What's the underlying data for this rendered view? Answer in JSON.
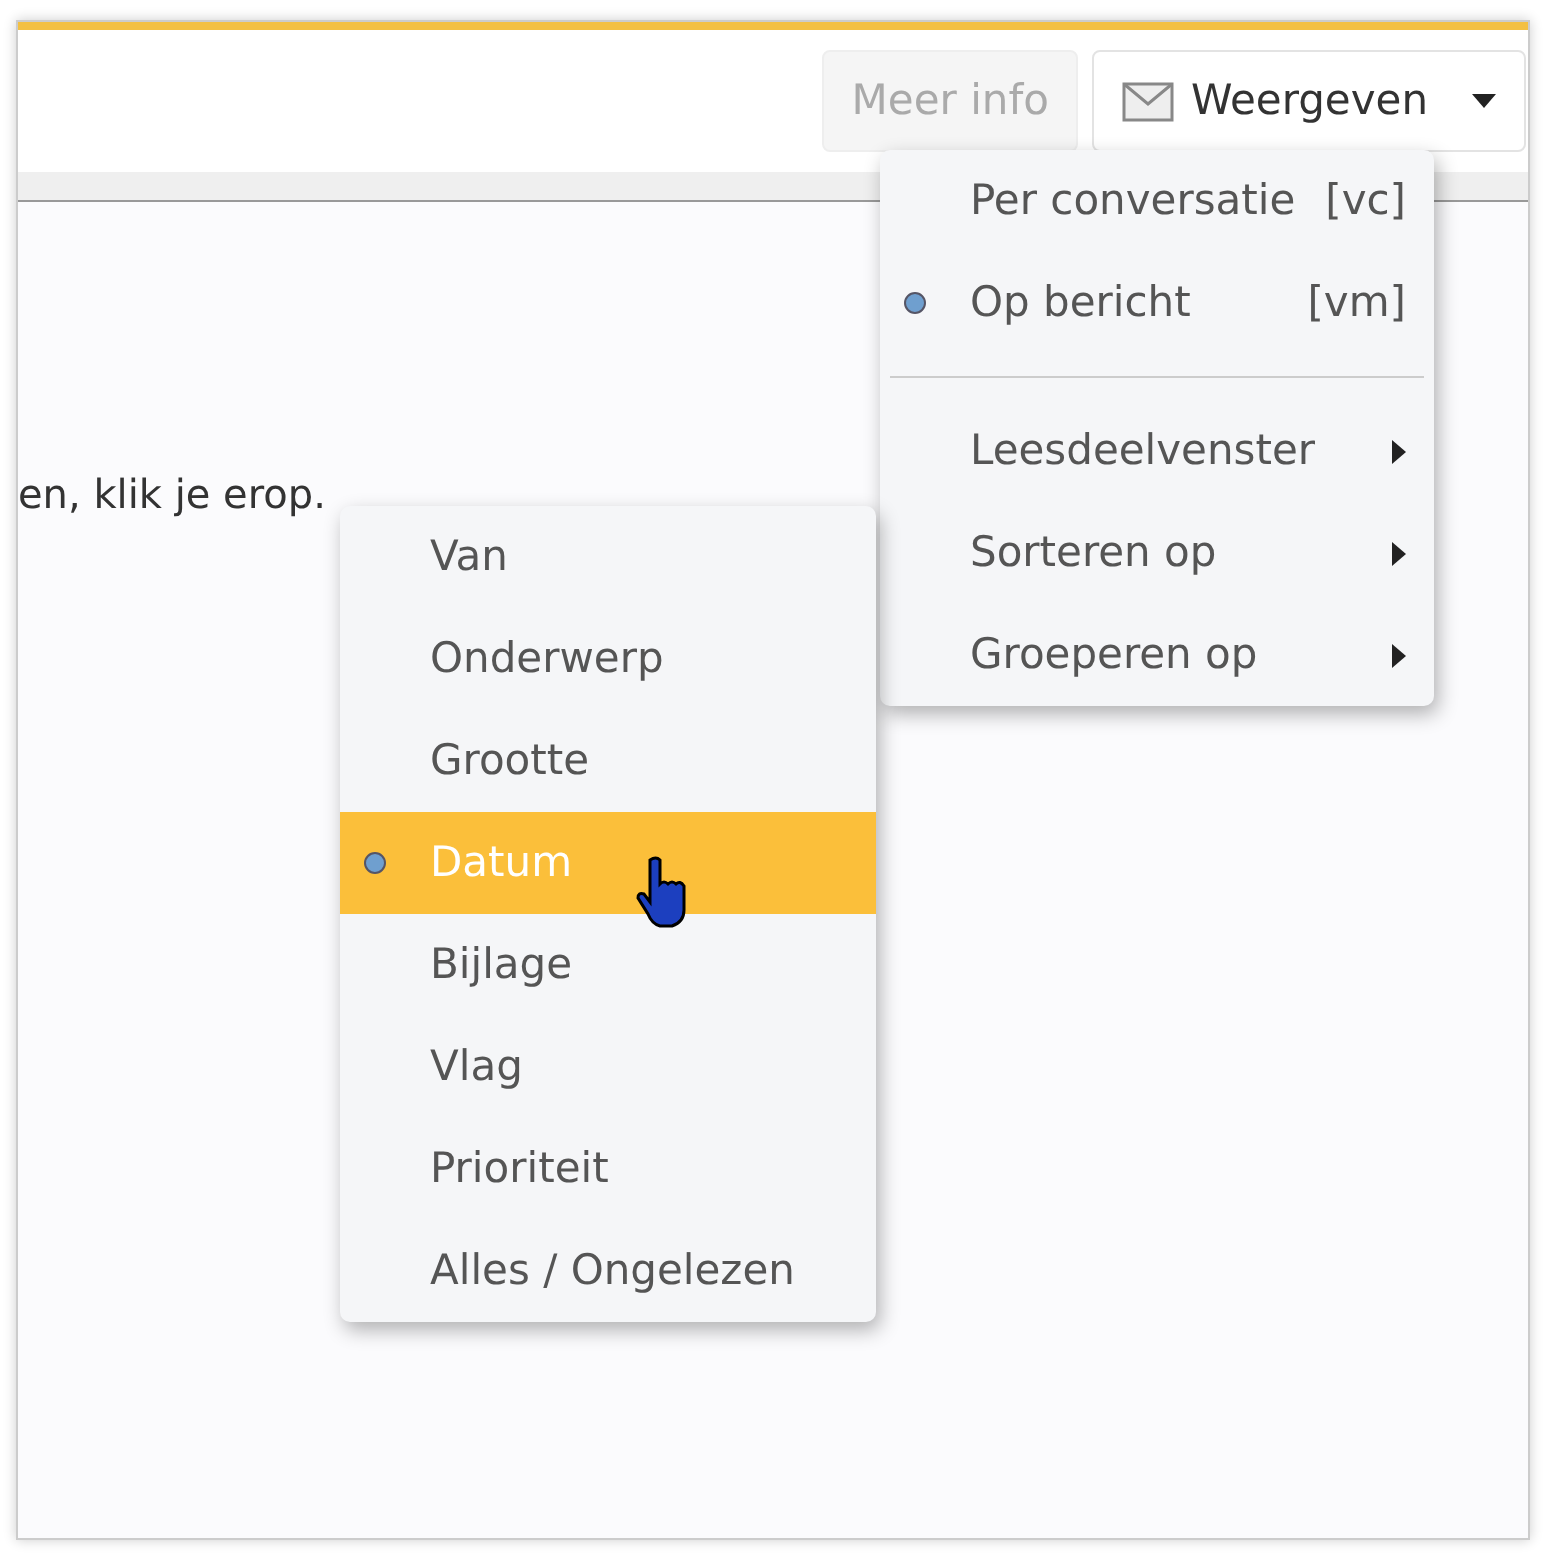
{
  "toolbar": {
    "buttons": [
      {
        "kind": "plain",
        "label": "Meer info",
        "disabled": true
      },
      {
        "kind": "dropdown",
        "label": "Weergeven",
        "disabled": false
      }
    ]
  },
  "content": {
    "text": "en, klik je erop."
  },
  "view_menu": {
    "items": [
      {
        "kind": "radio",
        "label": "Per conversatie",
        "shortcut": "[vc]",
        "selected": false
      },
      {
        "kind": "radio",
        "label": "Op bericht",
        "shortcut": "[vm]",
        "selected": true
      },
      {
        "kind": "separator"
      },
      {
        "kind": "submenu",
        "label": "Leesdeelvenster"
      },
      {
        "kind": "submenu",
        "label": "Sorteren op"
      },
      {
        "kind": "submenu",
        "label": "Groeperen op"
      }
    ]
  },
  "sort_menu": {
    "items": [
      {
        "label": "Van",
        "selected": false,
        "hovered": false
      },
      {
        "label": "Onderwerp",
        "selected": false,
        "hovered": false
      },
      {
        "label": "Grootte",
        "selected": false,
        "hovered": false
      },
      {
        "label": "Datum",
        "selected": true,
        "hovered": true
      },
      {
        "label": "Bijlage",
        "selected": false,
        "hovered": false
      },
      {
        "label": "Vlag",
        "selected": false,
        "hovered": false
      },
      {
        "label": "Prioriteit",
        "selected": false,
        "hovered": false
      },
      {
        "label": "Alles / Ongelezen",
        "selected": false,
        "hovered": false
      }
    ]
  }
}
